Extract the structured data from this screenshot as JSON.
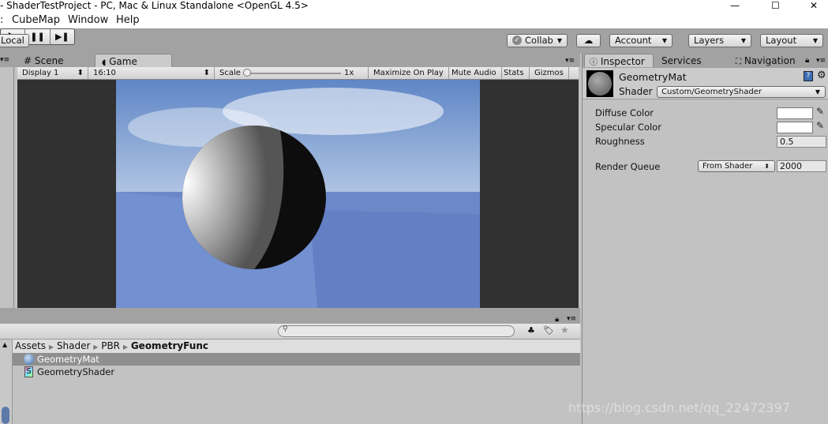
{
  "window": {
    "title": "- ShaderTestProject - PC, Mac & Linux Standalone   <OpenGL 4.5>",
    "minimize": "—",
    "maximize": "☐",
    "close": "✕"
  },
  "menu": {
    "items": [
      ":",
      "CubeMap",
      "Window",
      "Help"
    ]
  },
  "toolbar": {
    "local": "Local",
    "play": "▶",
    "pause": "❚❚",
    "step": "▶❚",
    "collab": "Collab",
    "account": "Account",
    "layers": "Layers",
    "layout": "Layout"
  },
  "tabs": {
    "scene": "Scene",
    "game": "Game",
    "menu": "▾≡"
  },
  "game": {
    "display": "Display 1",
    "aspect": "16:10",
    "scale_label": "Scale",
    "scale_value": "1x",
    "scale_fraction": 0,
    "maximize": "Maximize On Play",
    "mute": "Mute Audio",
    "stats": "Stats",
    "gizmos": "Gizmos"
  },
  "inspector": {
    "tabs": [
      "Inspector",
      "Services",
      "Navigation"
    ],
    "material_name": "GeometryMat",
    "shader_label": "Shader",
    "shader_value": "Custom/GeometryShader",
    "properties": [
      {
        "label": "Diffuse Color",
        "color": "#ffffff"
      },
      {
        "label": "Specular Color",
        "color": "#ffffff"
      },
      {
        "label": "Roughness",
        "value": "0.5"
      }
    ],
    "render_queue_label": "Render Queue",
    "render_queue_mode": "From Shader",
    "render_queue_value": "2000"
  },
  "project": {
    "search_placeholder": "",
    "breadcrumb": [
      "Assets",
      "Shader",
      "PBR",
      "GeometryFunc"
    ],
    "items": [
      {
        "name": "GeometryMat",
        "selected": true
      },
      {
        "name": "GeometryShader",
        "selected": false
      }
    ]
  },
  "watermark": "https://blog.csdn.net/qq_22472397"
}
